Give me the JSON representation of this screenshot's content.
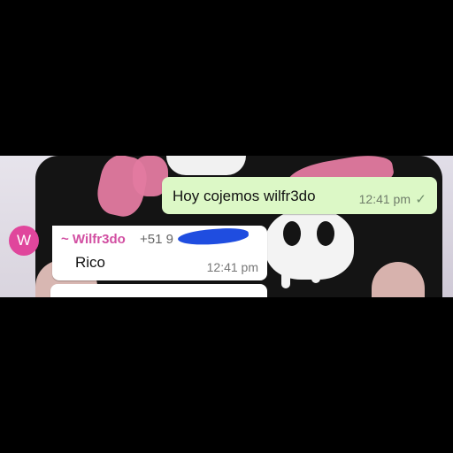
{
  "outgoing": {
    "text": "Hoy cojemos wilfr3do",
    "time": "12:41 pm",
    "tick": "✓",
    "bubble_color": "#dcf8c6"
  },
  "incoming": {
    "avatar_letter": "W",
    "avatar_color": "#e0469c",
    "sender": "~ Wilfr3do",
    "sender_color": "#d24fa2",
    "phone": "+51 9",
    "text": "Rico",
    "time": "12:41 pm"
  }
}
